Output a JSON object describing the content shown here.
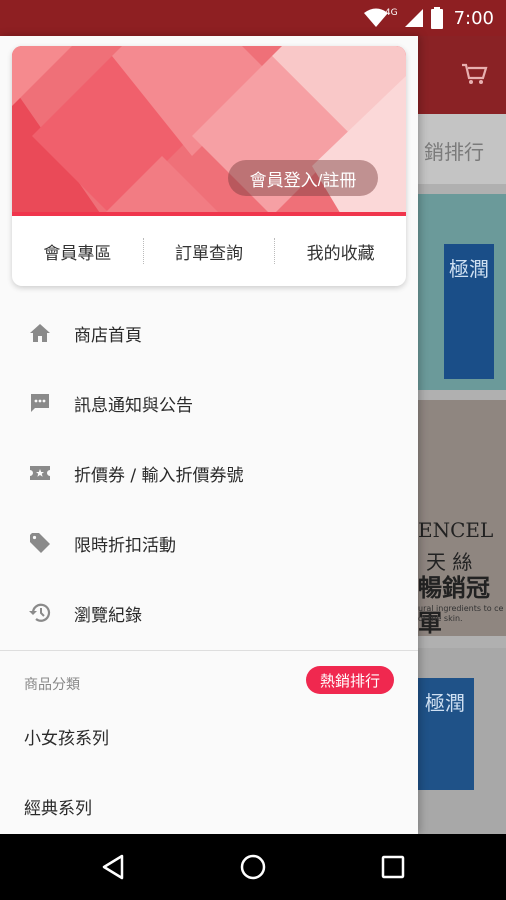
{
  "status_bar": {
    "time": "7:00",
    "network": "4G",
    "icons": [
      "wifi-icon",
      "signal-icon",
      "battery-icon"
    ]
  },
  "drawer": {
    "login_button": "會員登入/註冊",
    "quick_links": [
      "會員專區",
      "訂單查詢",
      "我的收藏"
    ],
    "menu_items": [
      {
        "icon": "home-icon",
        "label": "商店首頁"
      },
      {
        "icon": "message-icon",
        "label": "訊息通知與公告"
      },
      {
        "icon": "ticket-icon",
        "label": "折價券 / 輸入折價券號"
      },
      {
        "icon": "tag-icon",
        "label": "限時折扣活動"
      },
      {
        "icon": "history-icon",
        "label": "瀏覽紀錄"
      }
    ],
    "category_header": "商品分類",
    "hot_badge": "熱銷排行",
    "categories": [
      "小女孩系列",
      "經典系列"
    ]
  },
  "background_app": {
    "tab_fragment": "銷排行",
    "product_text": [
      "極潤",
      "ENCEL",
      "天 絲",
      "暢銷冠軍",
      "極潤"
    ],
    "fine_print": "ural ingredients to ce of the skin."
  },
  "colors": {
    "status_bar": "#8e1f22",
    "accent": "#f0284f",
    "banner": "#ee6c74"
  }
}
